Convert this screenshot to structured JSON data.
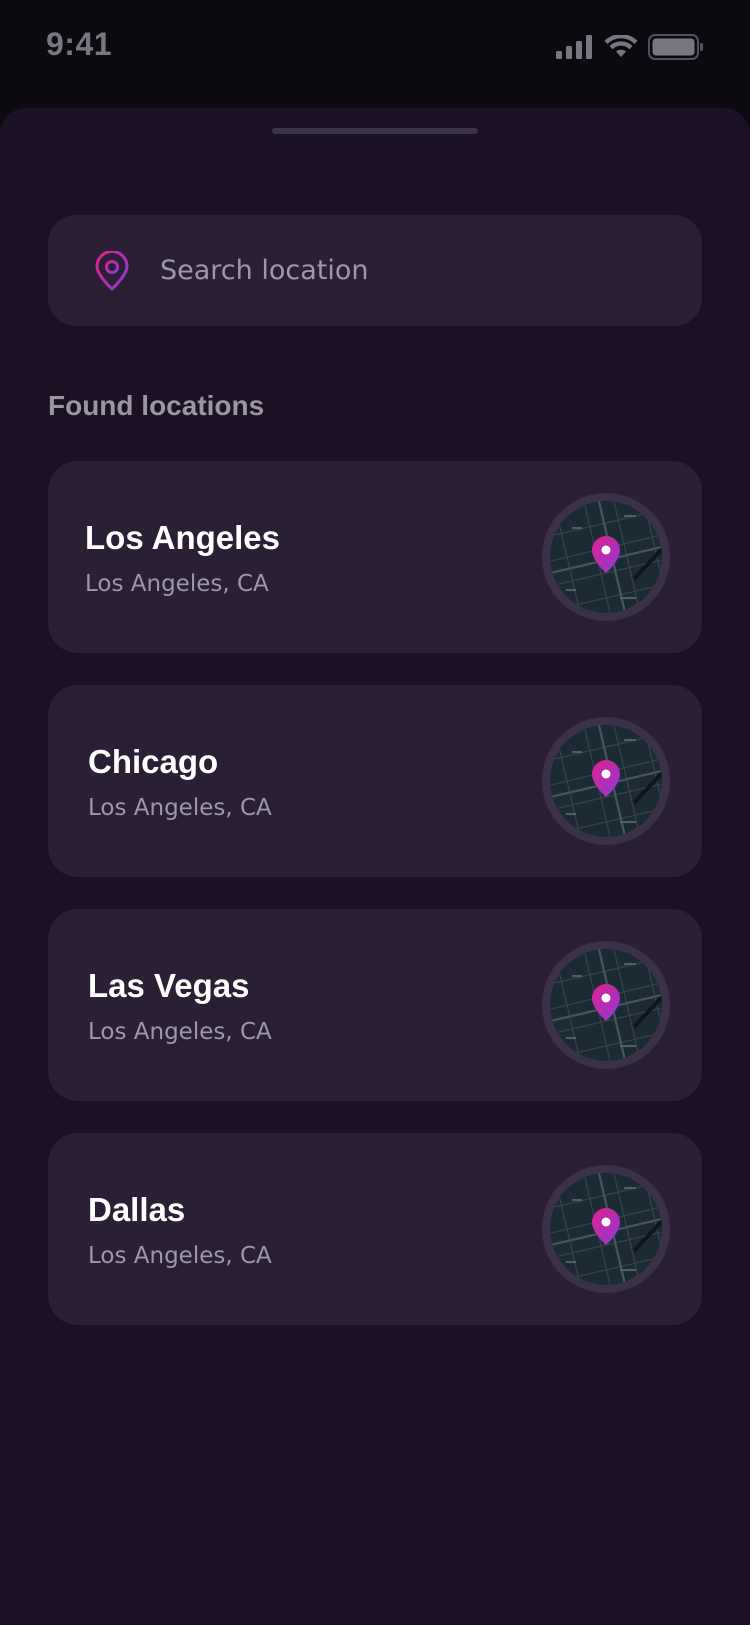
{
  "status_bar": {
    "time": "9:41",
    "icons": [
      "signal-icon",
      "wifi-icon",
      "battery-icon"
    ]
  },
  "search": {
    "placeholder": "Search location",
    "value": "",
    "icon": "location-pin-icon"
  },
  "section_label": "Found locations",
  "locations": [
    {
      "name": "Los Angeles",
      "address": "Los Angeles, CA"
    },
    {
      "name": "Chicago",
      "address": "Los Angeles, CA"
    },
    {
      "name": "Las Vegas",
      "address": "Los Angeles, CA"
    },
    {
      "name": "Dallas",
      "address": "Los Angeles, CA"
    }
  ],
  "colors": {
    "background": "#0c0910",
    "sheet": "#1c1024",
    "card": "#2a1f35",
    "accent_pink": "#e2218e",
    "accent_purple": "#8a3ad6",
    "text_primary": "#ffffff",
    "text_secondary": "#9d97a6"
  }
}
